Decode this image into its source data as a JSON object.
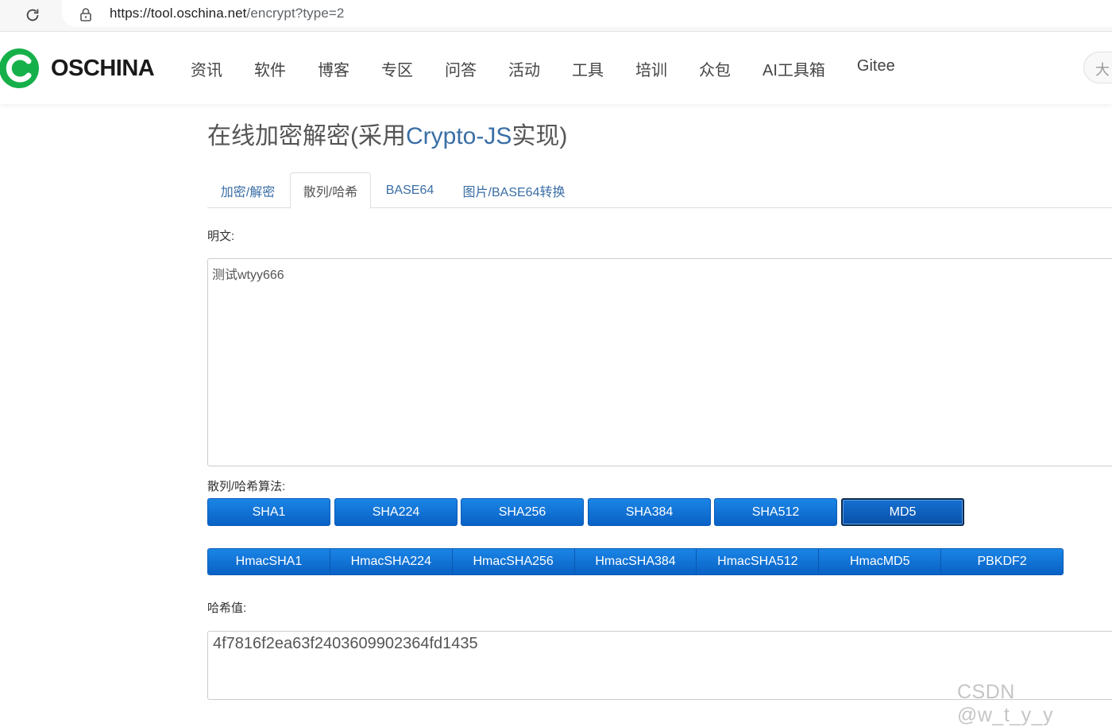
{
  "browser": {
    "url_host": "https://tool.oschina.net",
    "url_path": "/encrypt?type=2"
  },
  "header": {
    "brand": "OSCHINA",
    "nav": [
      "资讯",
      "软件",
      "博客",
      "专区",
      "问答",
      "活动",
      "工具",
      "培训",
      "众包",
      "AI工具箱",
      "Gitee"
    ],
    "search_partial": "大"
  },
  "page": {
    "title_prefix": "在线加密解密(采用",
    "title_highlight": "Crypto-JS",
    "title_suffix": "实现)"
  },
  "tabs": [
    {
      "label": "加密/解密",
      "active": false
    },
    {
      "label": "散列/哈希",
      "active": true
    },
    {
      "label": "BASE64",
      "active": false
    },
    {
      "label": "图片/BASE64转换",
      "active": false
    }
  ],
  "plaintext": {
    "label": "明文:",
    "value": "测试wtyy666"
  },
  "algorithms": {
    "label": "散列/哈希算法:",
    "hash_buttons": [
      {
        "label": "SHA1",
        "active": false
      },
      {
        "label": "SHA224",
        "active": false
      },
      {
        "label": "SHA256",
        "active": false
      },
      {
        "label": "SHA384",
        "active": false
      },
      {
        "label": "SHA512",
        "active": false
      },
      {
        "label": "MD5",
        "active": true
      }
    ],
    "hmac_buttons": [
      "HmacSHA1",
      "HmacSHA224",
      "HmacSHA256",
      "HmacSHA384",
      "HmacSHA512",
      "HmacMD5",
      "PBKDF2"
    ]
  },
  "result": {
    "label": "哈希值:",
    "value": "4f7816f2ea63f2403609902364fd1435"
  },
  "watermark": "CSDN @w_t_y_y",
  "colors": {
    "button_blue": "#0961c4",
    "link_blue": "#3a6ea5",
    "logo_green": "#16b04a"
  }
}
